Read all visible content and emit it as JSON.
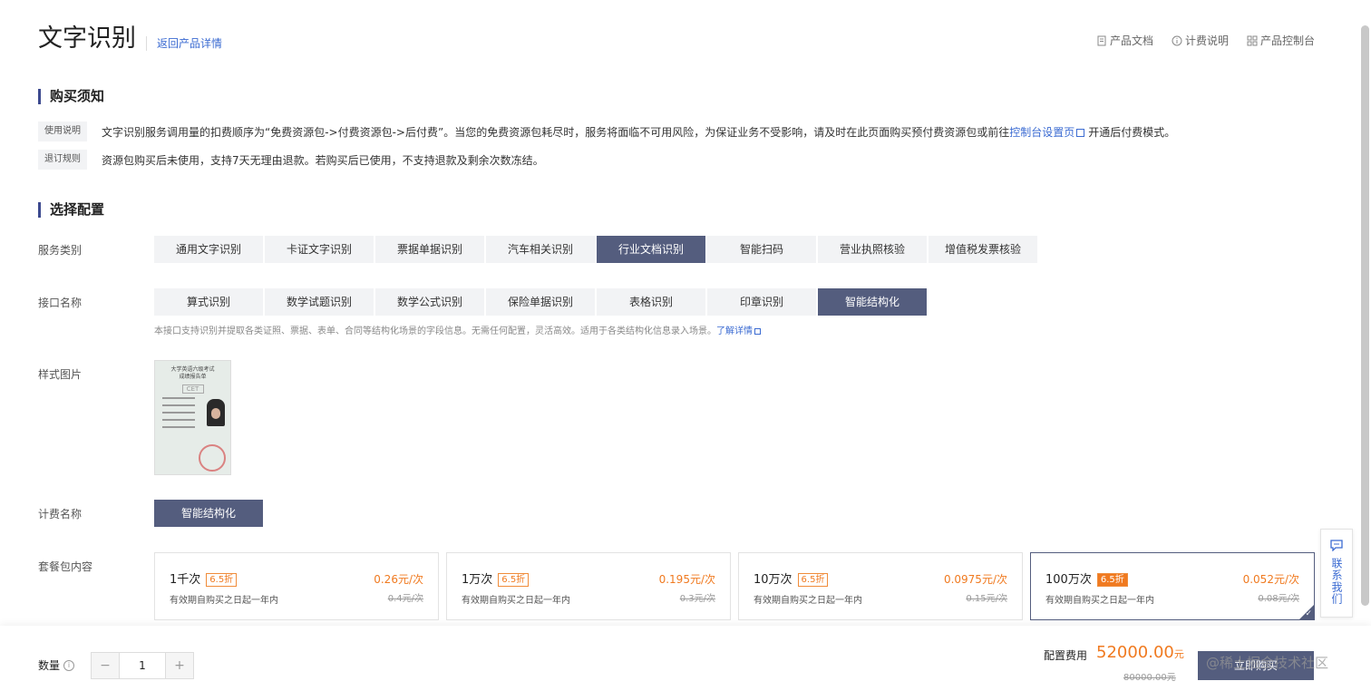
{
  "header": {
    "title": "文字识别",
    "back_link": "返回产品详情",
    "links": [
      "产品文档",
      "计费说明",
      "产品控制台"
    ]
  },
  "notice": {
    "title": "购买须知",
    "usage_tag": "使用说明",
    "usage_text": "文字识别服务调用量的扣费顺序为“免费资源包->付费资源包->后付费”。当您的免费资源包耗尽时，服务将面临不可用风险，为保证业务不受影响，请及时在此页面购买预付费资源包或前往",
    "usage_link": "控制台设置页",
    "usage_text_after": "开通后付费模式。",
    "refund_tag": "退订规则",
    "refund_text": "资源包购买后未使用，支持7天无理由退款。若购买后已使用，不支持退款及剩余次数冻结。"
  },
  "config": {
    "title": "选择配置",
    "service_label": "服务类别",
    "services": [
      "通用文字识别",
      "卡证文字识别",
      "票据单据识别",
      "汽车相关识别",
      "行业文档识别",
      "智能扫码",
      "营业执照核验",
      "增值税发票核验"
    ],
    "service_selected": "行业文档识别",
    "api_label": "接口名称",
    "apis": [
      "算式识别",
      "数学试题识别",
      "数学公式识别",
      "保险单据识别",
      "表格识别",
      "印章识别",
      "智能结构化"
    ],
    "api_selected": "智能结构化",
    "api_desc": "本接口支持识别并提取各类证照、票据、表单、合同等结构化场景的字段信息。无需任何配置，灵活高效。适用于各类结构化信息录入场景。",
    "api_desc_link": "了解详情",
    "sample_label": "样式图片",
    "sample_title": "大学英语六级考试\n成绩报告单",
    "sample_logo": "CET",
    "billing_label": "计费名称",
    "billing_name": "智能结构化",
    "package_label": "套餐包内容",
    "packages": [
      {
        "count": "1千次",
        "discount": "6.5折",
        "validity": "有效期自购买之日起一年内",
        "price": "0.26元/次",
        "original": "0.4元/次"
      },
      {
        "count": "1万次",
        "discount": "6.5折",
        "validity": "有效期自购买之日起一年内",
        "price": "0.195元/次",
        "original": "0.3元/次"
      },
      {
        "count": "10万次",
        "discount": "6.5折",
        "validity": "有效期自购买之日起一年内",
        "price": "0.0975元/次",
        "original": "0.15元/次"
      },
      {
        "count": "100万次",
        "discount": "6.5折",
        "validity": "有效期自购买之日起一年内",
        "price": "0.052元/次",
        "original": "0.08元/次"
      }
    ],
    "package_selected": "100万次"
  },
  "contact": {
    "label": "联系我们"
  },
  "footer": {
    "quantity_label": "数量",
    "quantity": "1",
    "minus": "−",
    "plus": "+",
    "fee_label": "配置费用",
    "fee_price": "52000.00",
    "fee_unit": "元",
    "fee_original": "80000.00元",
    "buy_label": "立即购买",
    "watermark": "@稀土掘金技术社区"
  },
  "colors": {
    "accent": "#545d7e",
    "price": "#f07a20",
    "link": "#3b6bd2"
  }
}
